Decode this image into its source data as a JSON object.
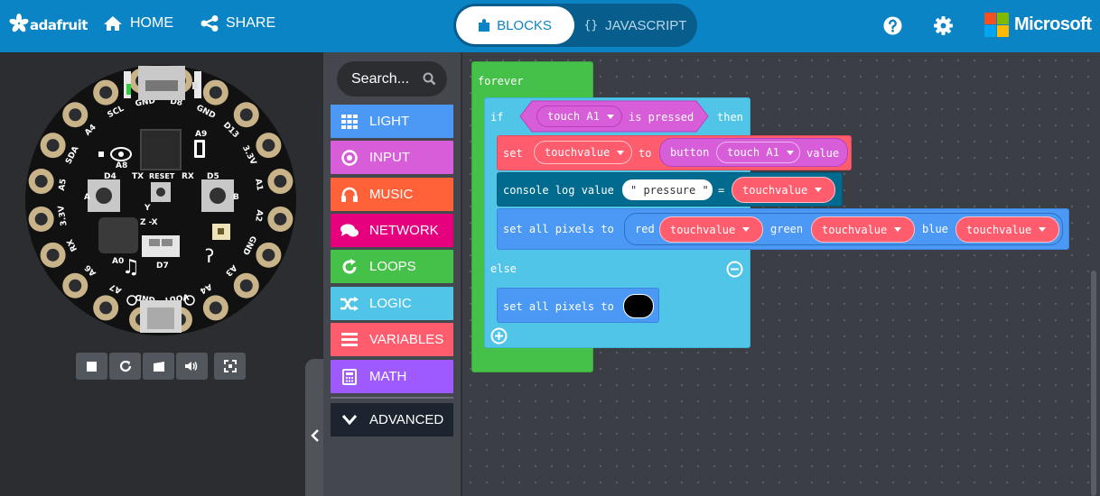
{
  "header": {
    "brand": "adafruit",
    "home_label": "HOME",
    "share_label": "SHARE",
    "blocks_label": "BLOCKS",
    "javascript_label": "JAVASCRIPT",
    "javascript_icon": "{}",
    "microsoft_label": "Microsoft",
    "icons": [
      "adafruit-logo-icon",
      "home-icon",
      "share-icon",
      "puzzle-icon",
      "help-icon",
      "gear-icon",
      "microsoft-logo-icon"
    ]
  },
  "simulator": {
    "pads": [
      "D8",
      "GND",
      "D13",
      "3.3V",
      "A1",
      "A2",
      "GND",
      "A3",
      "A4",
      "VOUT",
      "GND",
      "A7",
      "A6",
      "RX",
      "3.3V",
      "A5",
      "SDA",
      "A4",
      "SCL",
      "GND"
    ],
    "board_labels": {
      "a9": "A9",
      "a8": "A8",
      "d4": "D4",
      "tx": "TX",
      "reset": "RESET",
      "rx": "RX",
      "d5": "D5",
      "y": "Y",
      "zx": "Z -X",
      "a0": "A0",
      "d7": "D7",
      "a": "A",
      "b": "B"
    },
    "controls": [
      "stop-icon",
      "restart-icon",
      "debug-icon",
      "sound-icon",
      "fullscreen-icon"
    ]
  },
  "toolbox": {
    "search_placeholder": "Search...",
    "categories": [
      {
        "label": "LIGHT",
        "color": "#4b99f4",
        "icon": "grid-icon"
      },
      {
        "label": "INPUT",
        "color": "#d75dd9",
        "icon": "target-icon"
      },
      {
        "label": "MUSIC",
        "color": "#ff6138",
        "icon": "headphones-icon"
      },
      {
        "label": "NETWORK",
        "color": "#e6007d",
        "icon": "chat-icon"
      },
      {
        "label": "LOOPS",
        "color": "#45c048",
        "icon": "loop-icon"
      },
      {
        "label": "LOGIC",
        "color": "#51c5e8",
        "icon": "shuffle-icon"
      },
      {
        "label": "VARIABLES",
        "color": "#ff5c6e",
        "icon": "list-icon"
      },
      {
        "label": "MATH",
        "color": "#9f5aff",
        "icon": "calculator-icon"
      }
    ],
    "advanced_label": "ADVANCED"
  },
  "colors": {
    "header": "#0b84c5",
    "loops": "#45c048",
    "logic": "#51c5e8",
    "variables": "#ff5c6e",
    "console": "#006b8e",
    "light": "#4b99f4",
    "input": "#d75dd9"
  },
  "workspace": {
    "forever": "forever",
    "if_kw": "if",
    "then_kw": "then",
    "touch_input": "touch A1",
    "is_pressed": "is pressed",
    "set_kw": "set",
    "var_name": "touchvalue",
    "to_kw": "to",
    "button_kw": "button",
    "value_kw": "value",
    "console_log": "console log value",
    "console_string": "\" pressure \"",
    "equals": "=",
    "set_all_pixels": "set all pixels to",
    "red_kw": "red",
    "green_kw": "green",
    "blue_kw": "blue",
    "else_kw": "else",
    "pixel_color": "#000000"
  }
}
